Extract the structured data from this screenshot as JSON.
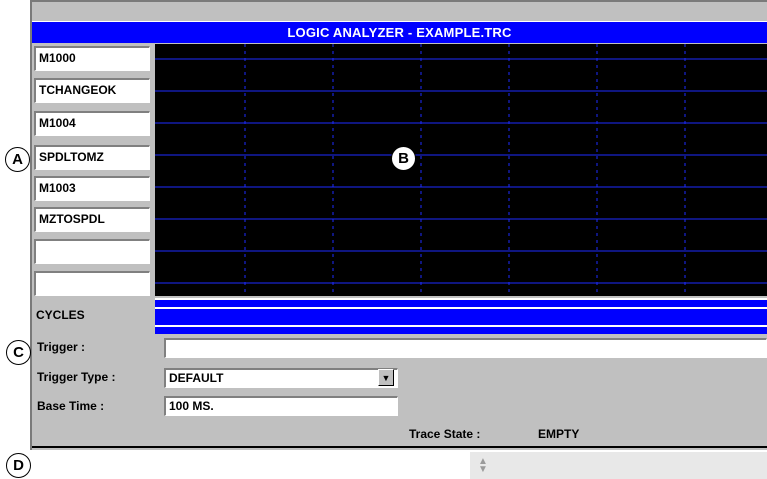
{
  "window": {
    "title": "LOGIC ANALYZER - EXAMPLE.TRC"
  },
  "signals": [
    "M1000",
    "TCHANGEOK",
    "M1004",
    "SPDLTOMZ",
    "M1003",
    "MZTOSPDL",
    "",
    ""
  ],
  "cycles_label": "CYCLES",
  "form": {
    "trigger_label": "Trigger :",
    "trigger_value": "",
    "trigger_type_label": "Trigger Type :",
    "trigger_type_value": "DEFAULT",
    "base_time_label": "Base Time :",
    "base_time_value": "100 MS.",
    "trace_state_label": "Trace State :",
    "trace_state_value": "EMPTY"
  },
  "callouts": {
    "a": "A",
    "b": "B",
    "c": "C",
    "d": "D"
  },
  "colors": {
    "title_bar": "#0000ff",
    "plot_bg": "#000000",
    "grid": "#1e2bff",
    "panel": "#c0c0c0"
  },
  "icons": {
    "dropdown": "chevron-down-icon",
    "spinner": "up-down-arrow-icon"
  }
}
